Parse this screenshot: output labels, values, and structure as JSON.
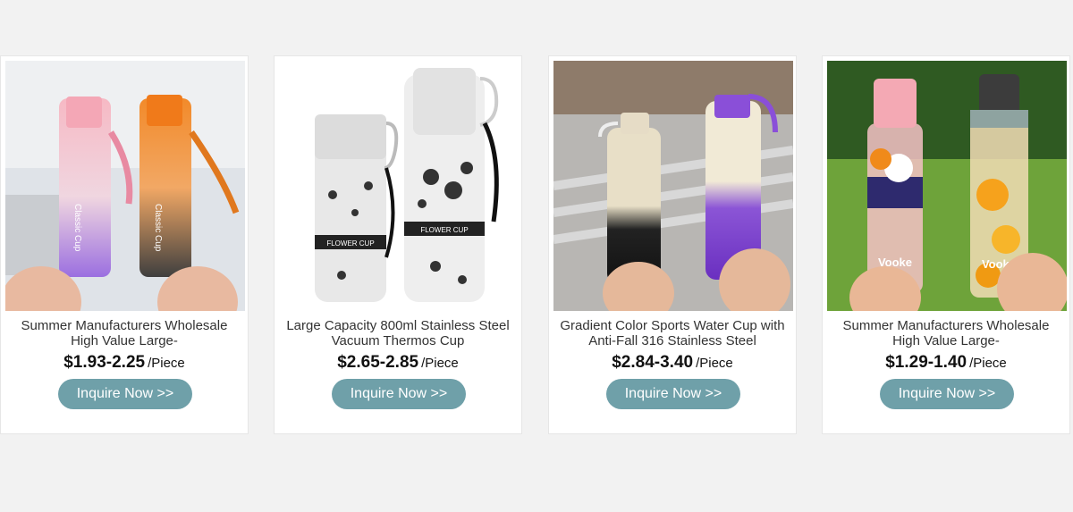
{
  "products": [
    {
      "title": "Summer Manufacturers Wholesale High Value Large-",
      "price": "$1.93-2.25",
      "unit": "/Piece",
      "button": "Inquire Now >>",
      "image_text": "Classic Cup"
    },
    {
      "title": "Large Capacity 800ml Stainless Steel Vacuum Thermos Cup",
      "price": "$2.65-2.85",
      "unit": "/Piece",
      "button": "Inquire Now >>",
      "image_text": "FLOWER CUP"
    },
    {
      "title": "Gradient Color Sports Water Cup with Anti-Fall 316 Stainless Steel",
      "price": "$2.84-3.40",
      "unit": "/Piece",
      "button": "Inquire Now >>"
    },
    {
      "title": "Summer Manufacturers Wholesale High Value Large-",
      "price": "$1.29-1.40",
      "unit": "/Piece",
      "button": "Inquire Now >>",
      "image_text": "Vooke"
    }
  ],
  "colors": {
    "button": "#6fa0a9",
    "page_background": "#f2f2f2"
  }
}
